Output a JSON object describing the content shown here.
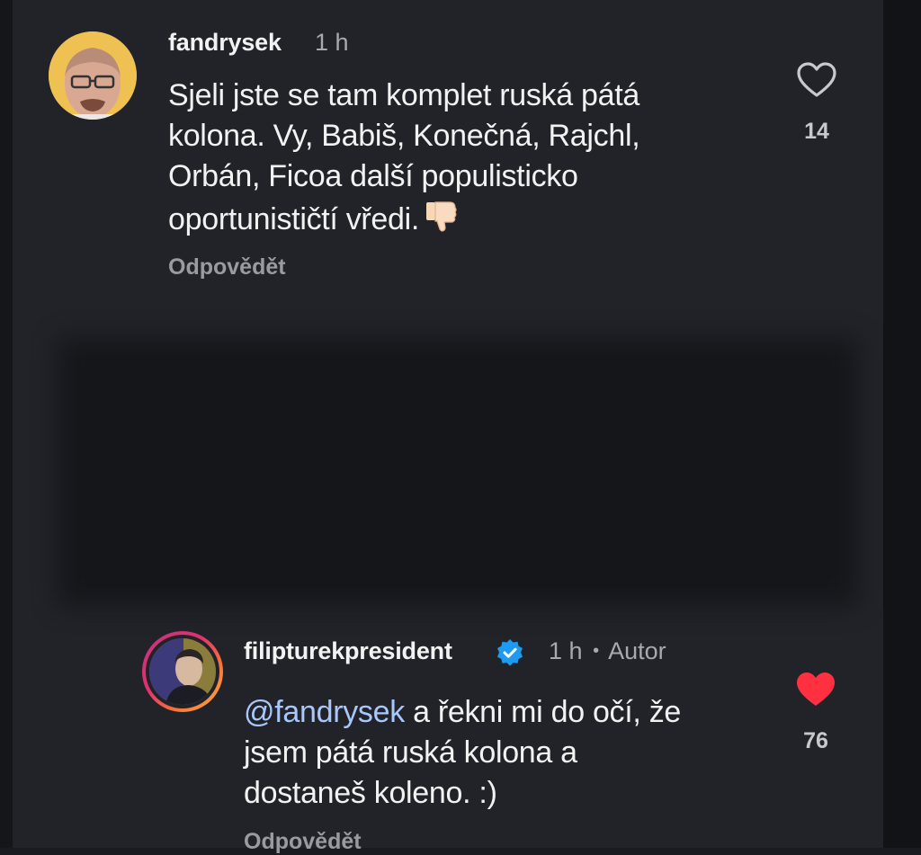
{
  "comment1": {
    "username": "fandrysek",
    "time": "1 h",
    "text": "Sjeli jste se tam komplet ruská pátá kolona. Vy, Babiš, Konečná, Rajchl, Orbán, Ficoa další populisticko oportunističtí vředi.",
    "line1": "Sjeli jste se tam komplet ruská pátá",
    "line2": "kolona. Vy, Babiš, Konečná, Rajchl,",
    "line3": "Orbán, Ficoa další populisticko",
    "line4": "oportunističtí vředi.",
    "emoji": "thumbs-down-emoji",
    "reply_label": "Odpovědět",
    "like_icon": "heart-outline-icon",
    "like_count": "14",
    "liked": false
  },
  "comment2": {
    "username": "filipturekpresident",
    "verified": true,
    "verified_icon": "verified-badge-icon",
    "time": "1 h",
    "separator": "•",
    "author_label": "Autor",
    "mention": "@fandrysek",
    "line1_rest": " a řekni mi do očí, že",
    "line2": "jsem pátá ruská kolona a",
    "line3": "dostaneš koleno. :)",
    "reply_label": "Odpovědět",
    "like_icon": "heart-filled-icon",
    "like_count": "76",
    "liked": true
  },
  "colors": {
    "background": "#222329",
    "text": "#f2f2f2",
    "muted": "#a8a8ad",
    "mention": "#a8c7fa",
    "heart_red": "#ff3040",
    "verified_blue": "#1d9bf0"
  }
}
